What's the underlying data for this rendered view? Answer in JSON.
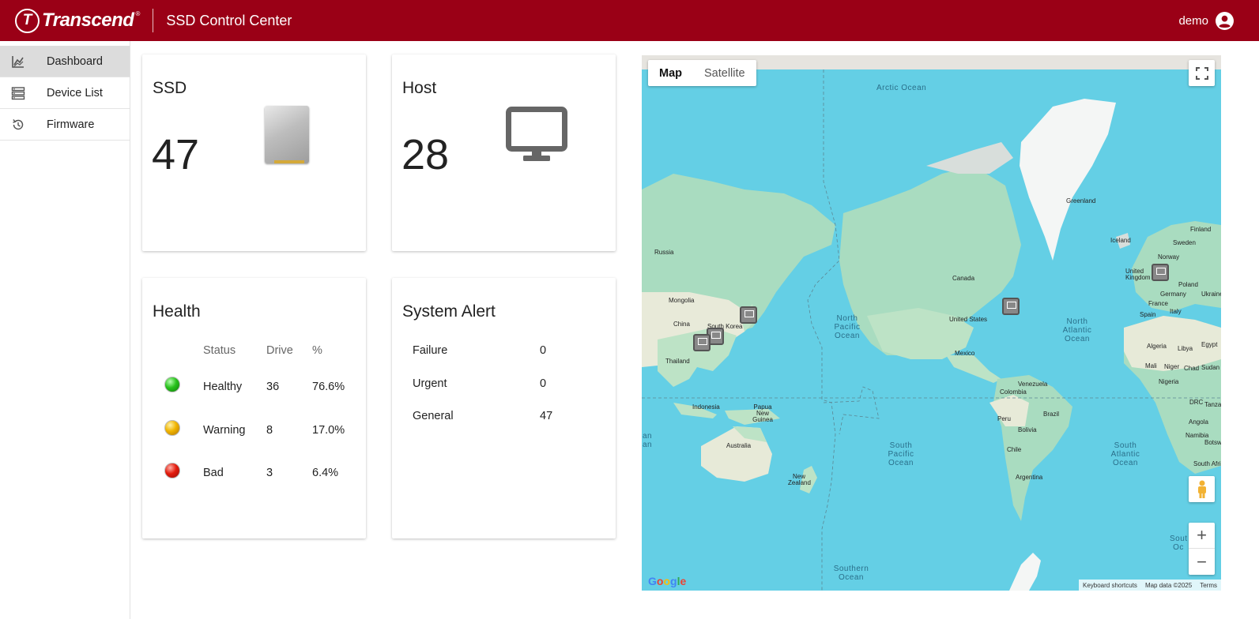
{
  "header": {
    "logo_text": "Transcend",
    "logo_mark": "T",
    "logo_reg": "®",
    "app_title": "SSD Control Center",
    "user_name": "demo",
    "user_icon": "account-circle-icon",
    "bg_color": "#9a0016"
  },
  "sidebar": {
    "items": [
      {
        "label": "Dashboard",
        "icon": "chart-line-icon",
        "active": true
      },
      {
        "label": "Device List",
        "icon": "server-list-icon",
        "active": false
      },
      {
        "label": "Firmware",
        "icon": "refresh-history-icon",
        "active": false
      }
    ]
  },
  "ssd_card": {
    "title": "SSD",
    "count": "47",
    "icon": "ssd-drive-icon"
  },
  "host_card": {
    "title": "Host",
    "count": "28",
    "icon": "monitor-icon"
  },
  "health_card": {
    "title": "Health",
    "headers": {
      "status": "Status",
      "drive": "Drive",
      "percent": "%"
    },
    "rows": [
      {
        "status": "Healthy",
        "drive": "36",
        "percent": "76.6%",
        "color": "green"
      },
      {
        "status": "Warning",
        "drive": "8",
        "percent": "17.0%",
        "color": "yellow"
      },
      {
        "status": "Bad",
        "drive": "3",
        "percent": "6.4%",
        "color": "red"
      }
    ]
  },
  "alert_card": {
    "title": "System Alert",
    "rows": [
      {
        "label": "Failure",
        "value": "0"
      },
      {
        "label": "Urgent",
        "value": "0"
      },
      {
        "label": "General",
        "value": "47"
      }
    ]
  },
  "map": {
    "type_map": "Map",
    "type_satellite": "Satellite",
    "zoom_in": "+",
    "zoom_out": "−",
    "google": "Google",
    "attrib_shortcuts": "Keyboard shortcuts",
    "attrib_data": "Map data ©2025",
    "attrib_terms": "Terms",
    "oceans": {
      "arctic": "Arctic Ocean",
      "north_pacific": "North Pacific Ocean",
      "north_atlantic": "North Atlantic Ocean",
      "south_pacific": "South Pacific Ocean",
      "south_atlantic": "South Atlantic Ocean",
      "southern": "Southern Ocean",
      "south_partial": "Sout Oc",
      "indian_partial": "an an"
    },
    "places": {
      "greenland": "Greenland",
      "iceland": "Iceland",
      "finland": "Finland",
      "sweden": "Sweden",
      "norway": "Norway",
      "uk": "United Kingdom",
      "poland": "Poland",
      "germany": "Germany",
      "ukraine": "Ukraine",
      "france": "France",
      "spain": "Spain",
      "italy": "Italy",
      "algeria": "Algeria",
      "libya": "Libya",
      "egypt": "Egypt",
      "mali": "Mali",
      "niger": "Niger",
      "chad": "Chad",
      "sudan": "Sudan",
      "nigeria": "Nigeria",
      "drc": "DRC",
      "tanzania": "Tanzania",
      "angola": "Angola",
      "namibia": "Namibia",
      "botswana": "Botswana",
      "south_africa": "South Africa",
      "russia": "Russia",
      "mongolia": "Mongolia",
      "china": "China",
      "south_korea": "South Korea",
      "thailand": "Thailand",
      "indonesia": "Indonesia",
      "png": "Papua New Guinea",
      "australia": "Australia",
      "nz": "New Zealand",
      "canada": "Canada",
      "usa": "United States",
      "mexico": "Mexico",
      "venezuela": "Venezuela",
      "colombia": "Colombia",
      "peru": "Peru",
      "brazil": "Brazil",
      "bolivia": "Bolivia",
      "chile": "Chile",
      "argentina": "Argentina"
    }
  }
}
